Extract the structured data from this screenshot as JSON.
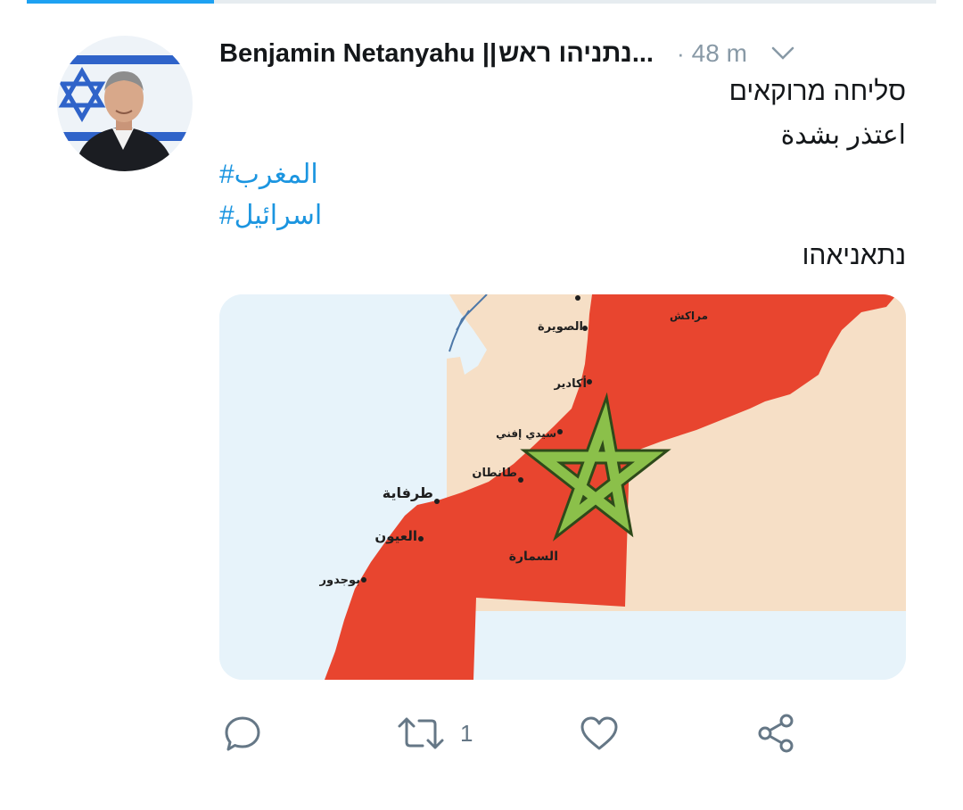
{
  "tweet": {
    "display_name": "Benjamin Netanyahu ||",
    "display_name_rtl": "נתניהו ראש",
    "display_name_ellipsis": "...",
    "separator": "·",
    "timestamp": "48 m",
    "lines": [
      "סליחה מרוקאים",
      "اعتذر بشدة"
    ],
    "hashtags": [
      "المغرب#",
      "اسرائيل#"
    ],
    "signature": "נתאניאהו"
  },
  "media": {
    "map_labels": {
      "essaouira": "الصويرة",
      "marrakech": "مراكش",
      "agadir": "أكادير",
      "sidi_ifni": "سيدي إفني",
      "tantan": "طانطان",
      "tarfaya": "طرفاية",
      "laayoune": "العيون",
      "smara": "السمارة",
      "boujdour": "بوجدور"
    },
    "colors": {
      "sea": "#e7f3fa",
      "morocco": "#e8452f",
      "neighbor": "#f6dfc6",
      "star": "#8bc04a"
    }
  },
  "actions": {
    "reply_icon": "comment-icon",
    "retweet_icon": "retweet-icon",
    "retweet_count": "1",
    "like_icon": "heart-icon",
    "share_icon": "share-icon"
  }
}
